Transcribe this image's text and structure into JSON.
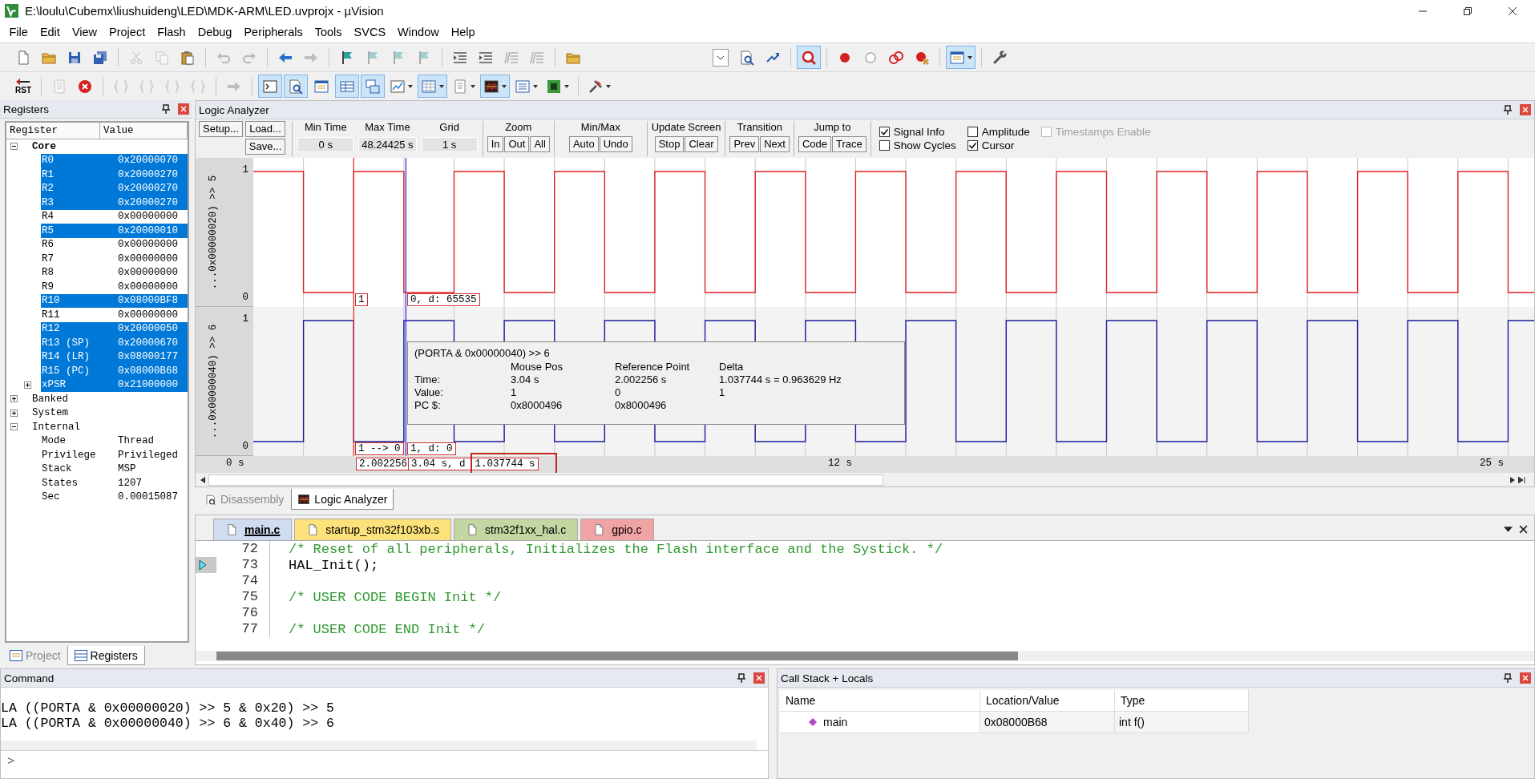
{
  "window": {
    "title": "E:\\loulu\\Cubemx\\liushuideng\\LED\\MDK-ARM\\LED.uvprojx - µVision"
  },
  "menu": [
    "File",
    "Edit",
    "View",
    "Project",
    "Flash",
    "Debug",
    "Peripherals",
    "Tools",
    "SVCS",
    "Window",
    "Help"
  ],
  "toolbar_1": [
    {
      "kind": "new",
      "on": false,
      "disabled": false
    },
    {
      "kind": "open",
      "on": false,
      "disabled": false
    },
    {
      "kind": "save",
      "on": false,
      "disabled": false
    },
    {
      "kind": "save-all",
      "on": false,
      "disabled": false
    },
    {
      "kind": "cut",
      "on": false,
      "disabled": true
    },
    {
      "kind": "copy",
      "on": false,
      "disabled": true
    },
    {
      "kind": "paste",
      "on": false,
      "disabled": false
    },
    {
      "kind": "undo",
      "on": false,
      "disabled": true
    },
    {
      "kind": "redo",
      "on": false,
      "disabled": true
    },
    {
      "kind": "back",
      "on": false,
      "disabled": false
    },
    {
      "kind": "forward",
      "on": false,
      "disabled": true
    },
    {
      "kind": "bookmark",
      "on": false,
      "disabled": false
    },
    {
      "kind": "prev-bookmark",
      "on": false,
      "disabled": true
    },
    {
      "kind": "next-bookmark",
      "on": false,
      "disabled": true
    },
    {
      "kind": "clear-bookmarks",
      "on": false,
      "disabled": true
    },
    {
      "kind": "indent",
      "on": false,
      "disabled": false
    },
    {
      "kind": "unindent",
      "on": false,
      "disabled": false
    },
    {
      "kind": "comment",
      "on": false,
      "disabled": true
    },
    {
      "kind": "uncomment",
      "on": false,
      "disabled": true
    },
    {
      "kind": "find-in-files",
      "on": false,
      "disabled": false
    },
    {
      "kind": "find-combo"
    },
    {
      "kind": "find",
      "on": false,
      "disabled": false
    },
    {
      "kind": "jump",
      "on": false,
      "disabled": false
    },
    {
      "kind": "debug",
      "on": true,
      "disabled": false
    },
    {
      "kind": "breakpoint",
      "on": false,
      "disabled": false
    },
    {
      "kind": "breakpoint-disable",
      "on": false,
      "disabled": false
    },
    {
      "kind": "breakpoints-disable-all",
      "on": false,
      "disabled": false
    },
    {
      "kind": "breakpoints-kill",
      "on": false,
      "disabled": false
    },
    {
      "kind": "window-layout",
      "on": true,
      "disabled": false
    },
    {
      "kind": "configure",
      "on": false,
      "disabled": false
    }
  ],
  "toolbar_2": [
    {
      "kind": "reset",
      "label": "RST",
      "on": false,
      "disabled": false
    },
    {
      "kind": "build-list",
      "on": false,
      "disabled": true
    },
    {
      "kind": "stop",
      "on": false,
      "disabled": false
    },
    {
      "kind": "step-into",
      "on": false,
      "disabled": true
    },
    {
      "kind": "step-over",
      "on": false,
      "disabled": true
    },
    {
      "kind": "step-out",
      "on": false,
      "disabled": true
    },
    {
      "kind": "run-to-cursor",
      "on": false,
      "disabled": true
    },
    {
      "kind": "show-next",
      "on": false,
      "disabled": true
    },
    {
      "kind": "command-window",
      "on": true,
      "disabled": false
    },
    {
      "kind": "disassembly-window",
      "on": true,
      "disabled": false
    },
    {
      "kind": "symbols-window",
      "on": false,
      "disabled": false
    },
    {
      "kind": "registers-window",
      "on": true,
      "disabled": false
    },
    {
      "kind": "call-stack-window",
      "on": true,
      "disabled": false
    },
    {
      "kind": "watch-window",
      "on": false,
      "disabled": false
    },
    {
      "kind": "memory-window",
      "on": true,
      "disabled": false
    },
    {
      "kind": "serial-window",
      "on": false,
      "disabled": false
    },
    {
      "kind": "analysis-window",
      "on": true,
      "disabled": false
    },
    {
      "kind": "trace-window",
      "on": false,
      "disabled": false
    },
    {
      "kind": "system-viewer",
      "on": false,
      "disabled": false
    },
    {
      "kind": "toolbox",
      "on": false,
      "disabled": false
    }
  ],
  "registers_panel": {
    "title": "Registers",
    "columns": [
      "Register",
      "Value"
    ],
    "tree": [
      {
        "name": "Core",
        "expanded": true,
        "selected": false,
        "children": [
          {
            "name": "R0",
            "value": "0x20000070",
            "selected": true
          },
          {
            "name": "R1",
            "value": "0x20000270",
            "selected": true
          },
          {
            "name": "R2",
            "value": "0x20000270",
            "selected": true
          },
          {
            "name": "R3",
            "value": "0x20000270",
            "selected": true
          },
          {
            "name": "R4",
            "value": "0x00000000",
            "selected": false
          },
          {
            "name": "R5",
            "value": "0x20000010",
            "selected": true
          },
          {
            "name": "R6",
            "value": "0x00000000",
            "selected": false
          },
          {
            "name": "R7",
            "value": "0x00000000",
            "selected": false
          },
          {
            "name": "R8",
            "value": "0x00000000",
            "selected": false
          },
          {
            "name": "R9",
            "value": "0x00000000",
            "selected": false
          },
          {
            "name": "R10",
            "value": "0x08000BF8",
            "selected": true
          },
          {
            "name": "R11",
            "value": "0x00000000",
            "selected": false
          },
          {
            "name": "R12",
            "value": "0x20000050",
            "selected": true
          },
          {
            "name": "R13 (SP)",
            "value": "0x20000670",
            "selected": true
          },
          {
            "name": "R14 (LR)",
            "value": "0x08000177",
            "selected": true
          },
          {
            "name": "R15 (PC)",
            "value": "0x08000B68",
            "selected": true
          },
          {
            "name": "xPSR",
            "value": "0x21000000",
            "selected": true,
            "expanded": false
          }
        ]
      },
      {
        "name": "Banked",
        "expanded": false,
        "selected": false
      },
      {
        "name": "System",
        "expanded": false,
        "selected": false
      },
      {
        "name": "Internal",
        "expanded": true,
        "selected": false,
        "children": [
          {
            "name": "Mode",
            "value": "Thread",
            "selected": false
          },
          {
            "name": "Privilege",
            "value": "Privileged",
            "selected": false
          },
          {
            "name": "Stack",
            "value": "MSP",
            "selected": false
          },
          {
            "name": "States",
            "value": "1207",
            "selected": false
          },
          {
            "name": "Sec",
            "value": "0.00015087",
            "selected": false
          }
        ]
      }
    ],
    "tabs": [
      {
        "label": "Project",
        "selected": false
      },
      {
        "label": "Registers",
        "selected": true
      }
    ]
  },
  "logic_analyzer": {
    "title": "Logic Analyzer",
    "file_buttons": [
      "Setup...",
      "Load...",
      "Save..."
    ],
    "fields": [
      {
        "label": "Min Time",
        "value": "0 s"
      },
      {
        "label": "Max Time",
        "value": "48.24425 s"
      },
      {
        "label": "Grid",
        "value": "1 s"
      }
    ],
    "button_groups": [
      {
        "label": "Zoom",
        "buttons": [
          "In",
          "Out",
          "All"
        ]
      },
      {
        "label": "Min/Max",
        "buttons": [
          "Auto",
          "Undo"
        ]
      },
      {
        "label": "Update Screen",
        "buttons": [
          "Stop",
          "Clear"
        ]
      },
      {
        "label": "Transition",
        "buttons": [
          "Prev",
          "Next"
        ]
      },
      {
        "label": "Jump to",
        "buttons": [
          "Code",
          "Trace"
        ]
      }
    ],
    "options": [
      {
        "label": "Signal Info",
        "checked": true,
        "disabled": false
      },
      {
        "label": "Amplitude",
        "checked": false,
        "disabled": false
      },
      {
        "label": "Timestamps Enable",
        "checked": false,
        "disabled": true
      },
      {
        "label": "Show Cycles",
        "checked": false,
        "disabled": false
      },
      {
        "label": "Cursor",
        "checked": true,
        "disabled": false
      }
    ],
    "signals": [
      {
        "label": "...0x00000020) >> 5",
        "color": "#e02020",
        "top_tick": "1",
        "bottom_tick": "0",
        "reference_value": "1",
        "cursor_value": "0,  d: 65535"
      },
      {
        "label": "...0x00000040) >> 6",
        "color": "#1c1c9c",
        "top_tick": "1",
        "bottom_tick": "0",
        "reference_value": "1 --> 0",
        "cursor_value": "1,  d: 0"
      }
    ],
    "axis_labels": [
      "0 s",
      "12 s",
      "25 s"
    ],
    "reference_time": "2.002256",
    "cursor_time": "3.04 s,  d",
    "delta_time": "1.037744 s",
    "info": {
      "title": "(PORTA & 0x00000040) >> 6",
      "columns": [
        "Mouse Pos",
        "Reference Point",
        "Delta"
      ],
      "rows": [
        {
          "label": "Time:",
          "cells": [
            "3.04 s",
            "2.002256 s",
            "1.037744 s = 0.963629 Hz"
          ]
        },
        {
          "label": "Value:",
          "cells": [
            "1",
            "0",
            "1"
          ]
        },
        {
          "label": "PC $:",
          "cells": [
            "0x8000496",
            "0x8000496"
          ]
        }
      ]
    }
  },
  "view_tabs": [
    {
      "label": "Disassembly",
      "selected": false
    },
    {
      "label": "Logic Analyzer",
      "selected": true
    }
  ],
  "editor": {
    "tabs": [
      {
        "label": "main.c",
        "selected": true,
        "color": "#cfdcf2"
      },
      {
        "label": "startup_stm32f103xb.s",
        "selected": false,
        "color": "#fde17a"
      },
      {
        "label": "stm32f1xx_hal.c",
        "selected": false,
        "color": "#c4d6a2"
      },
      {
        "label": "gpio.c",
        "selected": false,
        "color": "#f0a3a3"
      }
    ],
    "lines": [
      {
        "number": "72",
        "text": "/* Reset of all peripherals, Initializes the Flash interface and the Systick. */",
        "kind": "comment",
        "current": false
      },
      {
        "number": "73",
        "text": "HAL_Init();",
        "kind": "code",
        "current": true
      },
      {
        "number": "74",
        "kind": "code",
        "current": false
      },
      {
        "number": "75",
        "text": "/* USER CODE BEGIN Init */",
        "kind": "comment",
        "current": false
      },
      {
        "number": "76",
        "kind": "code",
        "current": false
      },
      {
        "number": "77",
        "text": "/* USER CODE END Init */",
        "kind": "comment",
        "current": false
      }
    ]
  },
  "command": {
    "title": "Command",
    "lines": [
      "LA ((PORTA & 0x00000020) >> 5 & 0x20) >> 5",
      "LA ((PORTA & 0x00000040) >> 6 & 0x40) >> 6"
    ],
    "prompt": ">"
  },
  "call_stack": {
    "title": "Call Stack + Locals",
    "columns": [
      "Name",
      "Location/Value",
      "Type"
    ],
    "rows": [
      {
        "name": "main",
        "value": "0x08000B68",
        "type": "int f()"
      }
    ]
  }
}
